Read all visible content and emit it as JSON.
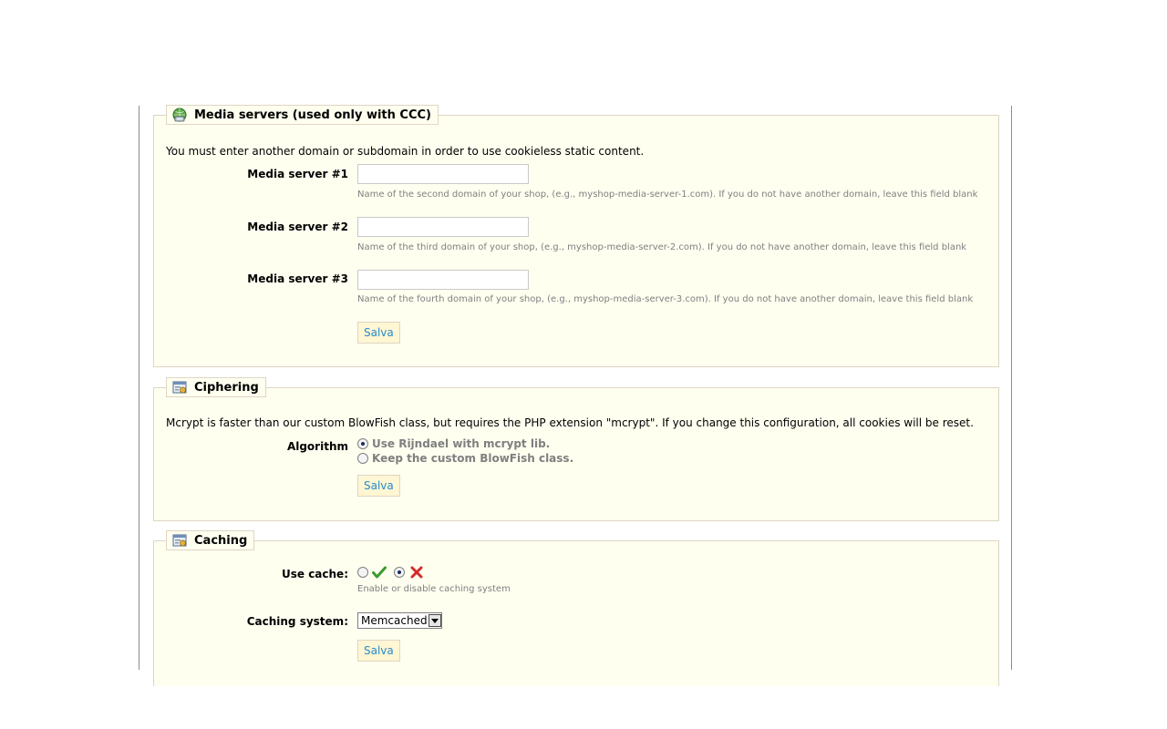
{
  "media_servers": {
    "title": "Media servers (used only with CCC)",
    "intro": "You must enter another domain or subdomain in order to use cookieless static content.",
    "fields": [
      {
        "label": "Media server #1",
        "value": "",
        "hint": "Name of the second domain of your shop, (e.g., myshop-media-server-1.com). If you do not have another domain, leave this field blank"
      },
      {
        "label": "Media server #2",
        "value": "",
        "hint": "Name of the third domain of your shop, (e.g., myshop-media-server-2.com). If you do not have another domain, leave this field blank"
      },
      {
        "label": "Media server #3",
        "value": "",
        "hint": "Name of the fourth domain of your shop, (e.g., myshop-media-server-3.com). If you do not have another domain, leave this field blank"
      }
    ],
    "save_label": "Salva"
  },
  "ciphering": {
    "title": "Ciphering",
    "intro": "Mcrypt is faster than our custom BlowFish class, but requires the PHP extension \"mcrypt\". If you change this configuration, all cookies will be reset.",
    "algorithm_label": "Algorithm",
    "options": [
      {
        "label": "Use Rijndael with mcrypt lib.",
        "selected": true
      },
      {
        "label": "Keep the custom BlowFish class.",
        "selected": false
      }
    ],
    "save_label": "Salva"
  },
  "caching": {
    "title": "Caching",
    "use_cache_label": "Use cache:",
    "use_cache_value": "disabled",
    "use_cache_hint": "Enable or disable caching system",
    "system_label": "Caching system:",
    "system_value": "Memcached",
    "save_label": "Salva"
  },
  "colors": {
    "panel_bg": "#fffff0",
    "panel_border": "#dfd5c3",
    "button_text": "#268ccd",
    "hint_text": "#7f7f7f",
    "enabled_icon": "#3c9a2e",
    "disabled_icon": "#d42a2a"
  },
  "icons": {
    "media_servers": "globe-network-icon",
    "ciphering": "window-settings-icon",
    "caching": "window-settings-icon",
    "enable": "checkmark-icon",
    "disable": "x-cross-icon"
  }
}
